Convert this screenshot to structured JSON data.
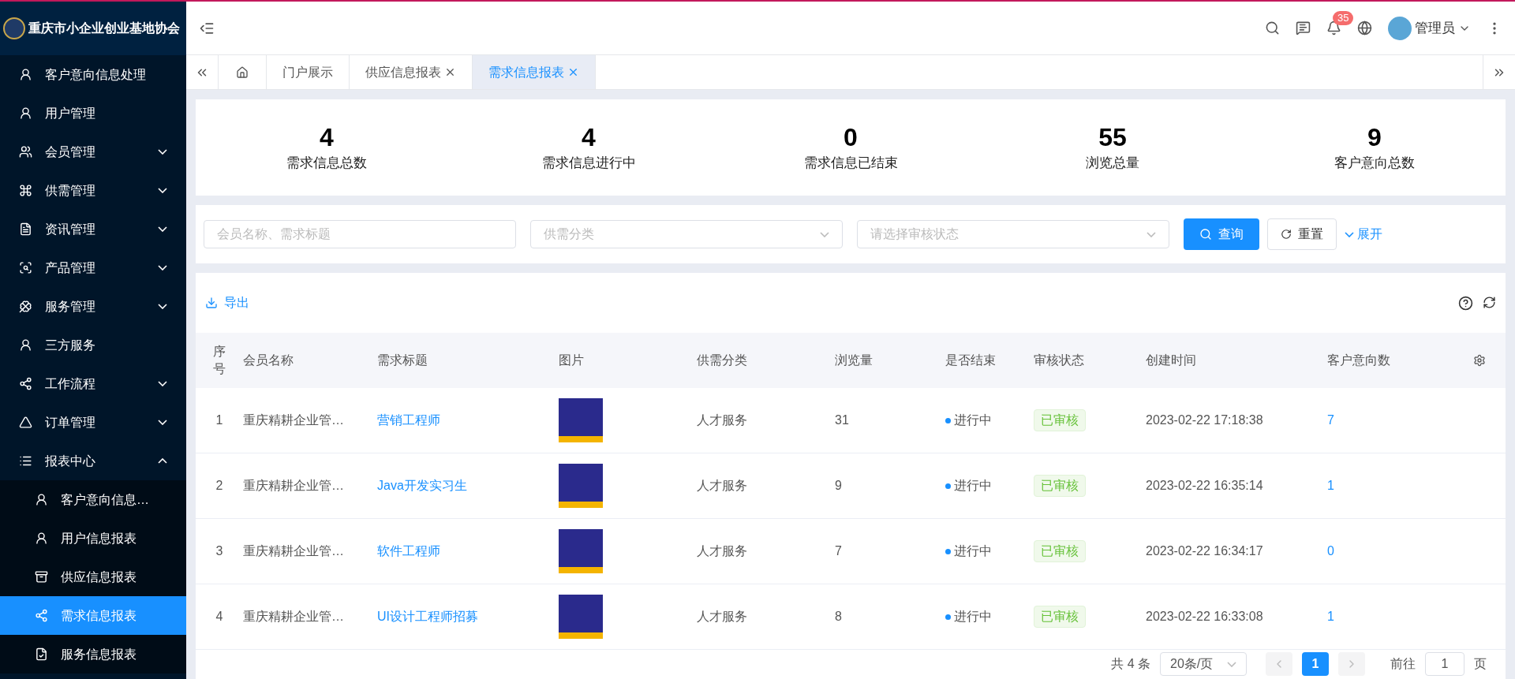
{
  "sidebar": {
    "title": "重庆市小企业创业基地协会",
    "items": [
      {
        "label": "客户意向信息处理"
      },
      {
        "label": "用户管理"
      },
      {
        "label": "会员管理",
        "expanded": false
      },
      {
        "label": "供需管理",
        "expanded": false
      },
      {
        "label": "资讯管理",
        "expanded": false
      },
      {
        "label": "产品管理",
        "expanded": false
      },
      {
        "label": "服务管理",
        "expanded": false
      },
      {
        "label": "三方服务"
      },
      {
        "label": "工作流程",
        "expanded": false
      },
      {
        "label": "订单管理",
        "expanded": false
      },
      {
        "label": "报表中心",
        "expanded": true,
        "children": [
          {
            "label": "客户意向信息…",
            "selected": false
          },
          {
            "label": "用户信息报表",
            "selected": false
          },
          {
            "label": "供应信息报表",
            "selected": false
          },
          {
            "label": "需求信息报表",
            "selected": true
          },
          {
            "label": "服务信息报表",
            "selected": false
          }
        ]
      }
    ]
  },
  "header": {
    "notification_count": "35",
    "user": "管理员"
  },
  "tabs": [
    {
      "label": "门户展示",
      "selected": false,
      "closable": false
    },
    {
      "label": "供应信息报表",
      "selected": false,
      "closable": true
    },
    {
      "label": "需求信息报表",
      "selected": true,
      "closable": true
    }
  ],
  "stats": [
    {
      "value": "4",
      "label": "需求信息总数"
    },
    {
      "value": "4",
      "label": "需求信息进行中"
    },
    {
      "value": "0",
      "label": "需求信息已结束"
    },
    {
      "value": "55",
      "label": "浏览总量"
    },
    {
      "value": "9",
      "label": "客户意向总数"
    }
  ],
  "filters": {
    "keyword": {
      "placeholder": "会员名称、需求标题"
    },
    "category": {
      "placeholder": "供需分类"
    },
    "status": {
      "placeholder": "请选择审核状态"
    },
    "search_button": "查询",
    "reset_button": "重置",
    "expand_link": "展开"
  },
  "toolbar": {
    "export": "导出"
  },
  "table": {
    "columns": [
      "序号",
      "会员名称",
      "需求标题",
      "图片",
      "供需分类",
      "浏览量",
      "是否结束",
      "审核状态",
      "创建时间",
      "客户意向数"
    ],
    "rows": [
      {
        "index": "1",
        "member": "重庆精耕企业管…",
        "title": "营销工程师",
        "category": "人才服务",
        "views": "31",
        "ended": "进行中",
        "color": "#1890ff",
        "review": "已审核",
        "created": "2023-02-22 17:18:38",
        "intents": "7"
      },
      {
        "index": "2",
        "member": "重庆精耕企业管…",
        "title": "Java开发实习生",
        "category": "人才服务",
        "views": "9",
        "ended": "进行中",
        "color": "#1890ff",
        "review": "已审核",
        "created": "2023-02-22 16:35:14",
        "intents": "1"
      },
      {
        "index": "3",
        "member": "重庆精耕企业管…",
        "title": "软件工程师",
        "category": "人才服务",
        "views": "7",
        "ended": "进行中",
        "color": "#1890ff",
        "review": "已审核",
        "created": "2023-02-22 16:34:17",
        "intents": "0"
      },
      {
        "index": "4",
        "member": "重庆精耕企业管…",
        "title": "UI设计工程师招募",
        "category": "人才服务",
        "views": "8",
        "ended": "进行中",
        "color": "#1890ff",
        "review": "已审核",
        "created": "2023-02-22 16:33:08",
        "intents": "1"
      }
    ]
  },
  "pagination": {
    "total": "共 4 条",
    "page_size": "20条/页",
    "pages": [
      {
        "label": "1",
        "selected": true
      }
    ],
    "jump_label": "前往",
    "jump_value": "1",
    "page_suffix": "页"
  }
}
